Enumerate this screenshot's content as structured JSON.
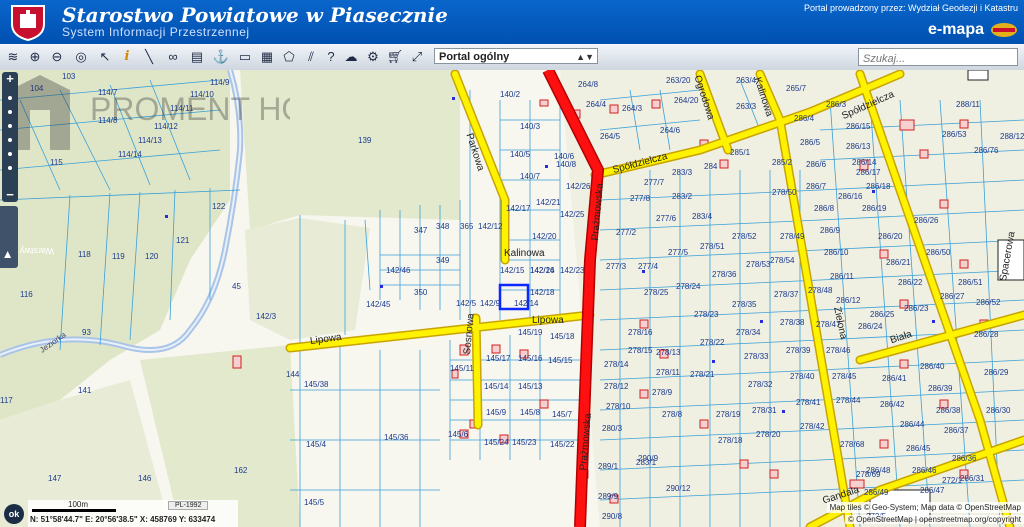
{
  "header": {
    "title": "Starostwo Powiatowe w Piasecznie",
    "subtitle": "System Informacji Przestrzennej",
    "provider": "Portal prowadzony przez: Wydział Geodezji i Katastru",
    "emapa": "e-mapa",
    "colors": {
      "bar": "#0a5fc2"
    }
  },
  "toolbar": {
    "icons": [
      "layers-icon",
      "zoom-in-icon",
      "zoom-out-icon",
      "zoom-extent-icon",
      "select-icon",
      "info-icon",
      "measure-icon",
      "link-icon",
      "print-icon",
      "anchor-icon",
      "window-icon",
      "layout-icon",
      "polygon-icon",
      "hatch-icon",
      "help-icon",
      "cloud-icon",
      "settings-icon",
      "cart-icon",
      "expand-icon"
    ],
    "portal_select": "Portal ogólny",
    "search_placeholder": "Szukaj..."
  },
  "map": {
    "parcels": [
      "103",
      "104",
      "114/9",
      "114/10",
      "114/7",
      "114/8",
      "114/11",
      "114/12",
      "114/13",
      "114/14",
      "115",
      "139",
      "122",
      "118",
      "119",
      "120",
      "121",
      "116",
      "45",
      "93",
      "142/3",
      "141",
      "117",
      "147",
      "146",
      "162",
      "144",
      "145/38",
      "145/4",
      "145/5",
      "145/36",
      "145/6",
      "145/11",
      "145/14",
      "145/17",
      "145/9",
      "145/24",
      "145/23",
      "145/19",
      "145/16",
      "145/13",
      "145/8",
      "145/15",
      "145/18",
      "145/7",
      "145/22",
      "142/5",
      "142/9",
      "142/14",
      "142/15",
      "142/16",
      "142/18",
      "142/12",
      "142/45",
      "142/46",
      "349",
      "350",
      "347",
      "348",
      "365",
      "142/17",
      "142/21",
      "142/20",
      "142/24",
      "142/23",
      "142/25",
      "142/26",
      "140/2",
      "140/3",
      "140/5",
      "140/6",
      "140/7",
      "140/8",
      "264/3",
      "264/8",
      "264/4",
      "264/5",
      "264/20",
      "263/20",
      "263/3",
      "263/4",
      "265/7",
      "264/6",
      "277/6",
      "277/5",
      "277/8",
      "277/2",
      "277/4",
      "277/3",
      "277/7",
      "278/25",
      "278/24",
      "278/23",
      "278/22",
      "278/21",
      "278/16",
      "278/15",
      "278/14",
      "278/13",
      "278/12",
      "278/11",
      "278/10",
      "278/9",
      "278/8",
      "280/3",
      "283/1",
      "283/2",
      "283/3",
      "283/4",
      "284",
      "285/1",
      "285/2",
      "278/50",
      "278/51",
      "278/52",
      "278/53",
      "278/54",
      "278/49",
      "278/36",
      "278/35",
      "278/34",
      "278/33",
      "278/32",
      "278/31",
      "278/20",
      "278/19",
      "278/18",
      "278/37",
      "278/38",
      "278/39",
      "278/40",
      "278/41",
      "278/42",
      "278/48",
      "278/47",
      "278/46",
      "278/45",
      "278/44",
      "278/68",
      "278/69",
      "286/3",
      "286/4",
      "286/5",
      "286/6",
      "286/7",
      "286/8",
      "286/9",
      "286/10",
      "286/11",
      "286/12",
      "286/13",
      "286/14",
      "286/15",
      "286/16",
      "286/17",
      "286/18",
      "286/19",
      "286/20",
      "286/21",
      "286/22",
      "286/23",
      "286/24",
      "286/25",
      "286/26",
      "286/27",
      "286/28",
      "286/29",
      "286/30",
      "286/31",
      "286/36",
      "286/37",
      "286/38",
      "286/39",
      "286/40",
      "286/41",
      "286/42",
      "286/44",
      "286/45",
      "286/46",
      "286/47",
      "286/48",
      "286/49",
      "286/50",
      "286/51",
      "286/52",
      "286/53",
      "286/76",
      "288/11",
      "288/12",
      "289/1",
      "289/9",
      "290/8",
      "290/9",
      "290/12",
      "272/5",
      "272/1",
      "272/2",
      "272/6",
      "272/7",
      "284/3",
      "286/36"
    ],
    "streets": [
      "Kalinowa",
      "Lipowa",
      "Lipowa",
      "Sosnowa",
      "Prażmowska",
      "Prażmowska",
      "Parkowa",
      "Spółdzielcza",
      "Spółdzielcza",
      "Ogrodowa",
      "Kalinowa",
      "Zielona",
      "Biała",
      "Spacerowa",
      "Gandala",
      "Jeziorka"
    ],
    "watermark_text": "PROMENT HOUSE"
  },
  "controls": {
    "layers_tab": "Warstwy",
    "ok_label": "ok",
    "scale_label": "100m",
    "crs": "PL-1992",
    "coordinates": "N: 51°58'44.7\"  E: 20°56'38.5\"  X: 458769   Y: 633474",
    "attribution_1": "Map tiles © Geo-System; Map data © OpenStreetMap",
    "attribution_2": "© OpenStreetMap | openstreetmap.org/copyright"
  }
}
